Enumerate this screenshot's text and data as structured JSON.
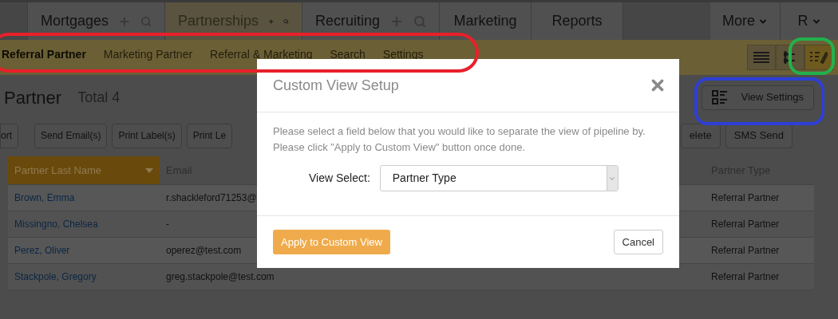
{
  "nav": {
    "tabs": [
      {
        "label": "Mortgages",
        "selected": false,
        "has_actions": true
      },
      {
        "label": "Partnerships",
        "selected": true,
        "has_actions": true
      },
      {
        "label": "Recruiting",
        "selected": false,
        "has_actions": true
      },
      {
        "label": "Marketing",
        "selected": false,
        "has_actions": false
      },
      {
        "label": "Reports",
        "selected": false,
        "has_actions": false
      }
    ],
    "more": "More",
    "user": "R"
  },
  "subnav": {
    "items": [
      {
        "label": "Referral Partner",
        "selected": true
      },
      {
        "label": "Marketing Partner",
        "selected": false
      },
      {
        "label": "Referral & Marketing",
        "selected": false
      },
      {
        "label": "Search",
        "selected": false
      },
      {
        "label": "Settings",
        "selected": false
      }
    ],
    "views": [
      {
        "kind": "list",
        "selected": false
      },
      {
        "kind": "timeline",
        "selected": false
      },
      {
        "kind": "custom",
        "selected": true
      }
    ]
  },
  "header": {
    "title": "Partner",
    "total": "Total 4",
    "view_settings": "View Settings"
  },
  "actions_left": [
    "ort",
    "Send Email(s)",
    "Print Label(s)",
    "Print Le"
  ],
  "actions_right": [
    "elete",
    "SMS Send"
  ],
  "table": {
    "columns": [
      {
        "label": "Partner Last Name",
        "sorted": true
      },
      {
        "label": "Email",
        "sorted": false
      },
      {
        "label": "Partner Type",
        "sorted": false
      }
    ],
    "rows": [
      {
        "name": "Brown, Emma",
        "email": "r.shackleford71253@",
        "type": "Referral Partner"
      },
      {
        "name": "Missingno, Chelsea",
        "email": "-",
        "type": "Referral Partner"
      },
      {
        "name": "Perez, Oliver",
        "email": "operez@test.com",
        "type": "Referral Partner"
      },
      {
        "name": "Stackpole, Gregory",
        "email": "greg.stackpole@test.com",
        "type": "Referral Partner"
      }
    ]
  },
  "modal": {
    "title": "Custom View Setup",
    "text": "Please select a field below that you would like to separate the view of pipeline by. Please click \"Apply to Custom View\" button once done.",
    "select_label": "View Select:",
    "select_value": "Partner Type",
    "apply": "Apply to Custom View",
    "cancel": "Cancel"
  },
  "annotations": [
    {
      "kind": "ellipse",
      "color": "#e8202a"
    },
    {
      "kind": "rounded",
      "color": "#2d3fd6"
    },
    {
      "kind": "rounded",
      "color": "#22b14c"
    }
  ]
}
